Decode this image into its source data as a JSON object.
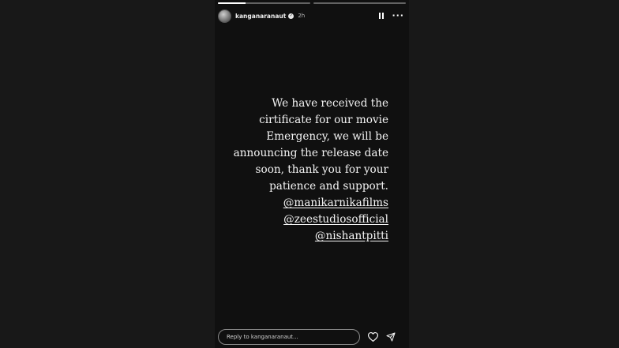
{
  "story": {
    "progress_segments": [
      0.3,
      0.0
    ],
    "header": {
      "username": "kanganaranaut",
      "time": "2h",
      "verified_icon": "verified-badge-icon",
      "pause_icon": "pause-icon",
      "more_icon": "more-options-icon"
    },
    "text_lines": [
      "We have received the",
      "cirtificate for our movie",
      "Emergency, we will be",
      "announcing the release date",
      "soon, thank you for your",
      "patience and support."
    ],
    "mentions": [
      "@manikarnikafilms",
      "@zeestudiosofficial",
      "@nishantpitti"
    ],
    "footer": {
      "reply_placeholder": "Reply to kanganaranaut...",
      "like_icon": "heart-icon",
      "share_icon": "send-icon"
    }
  }
}
